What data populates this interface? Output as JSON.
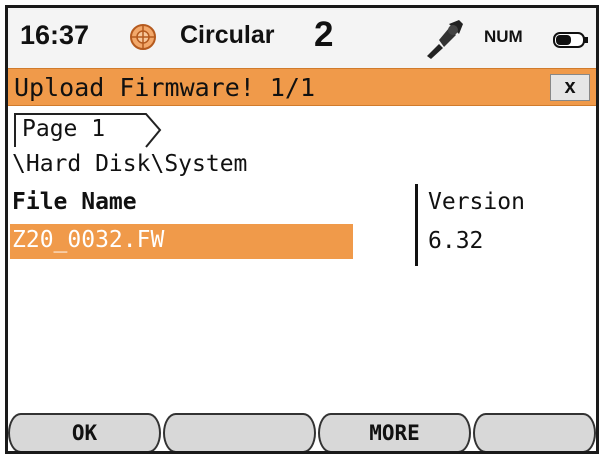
{
  "status_bar": {
    "time": "16:37",
    "target_icon": "prism-target-icon",
    "mode": "Circular",
    "face": "2",
    "probe_icon": "probe-icon",
    "keyboard_mode": "NUM",
    "battery_icon": "battery-icon"
  },
  "dialog": {
    "title": "Upload Firmware! 1/1",
    "close_label": "x",
    "tab_label": "Page 1",
    "path": "\\Hard Disk\\System",
    "columns": [
      "File Name",
      "Version"
    ],
    "rows": [
      {
        "file_name": "Z20_0032.FW",
        "version": "6.32",
        "selected": true
      }
    ]
  },
  "softkeys": [
    "OK",
    "",
    "MORE",
    ""
  ],
  "colors": {
    "accent": "#f09a4a",
    "selected_text": "#ffffff",
    "softkey_bg": "#d8d8d8"
  }
}
